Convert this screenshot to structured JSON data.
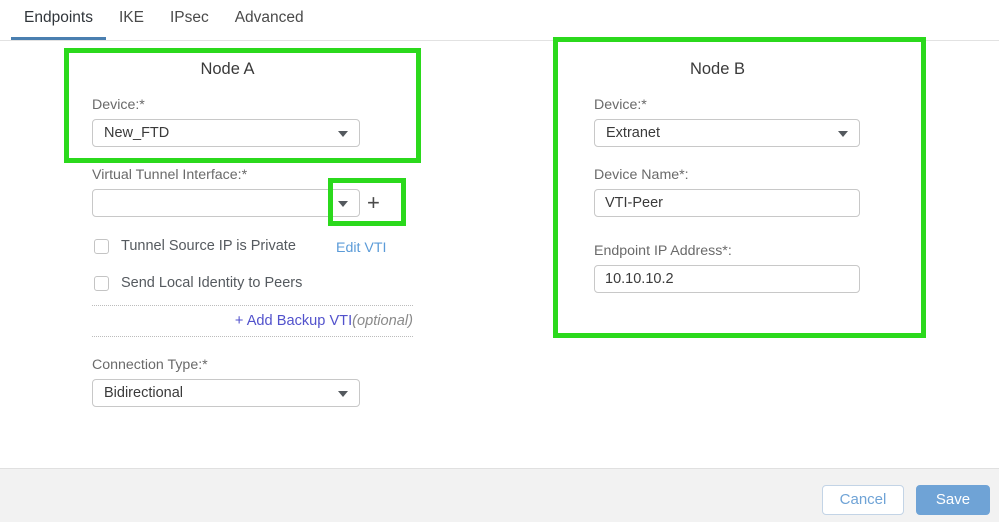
{
  "tabs": [
    {
      "label": "Endpoints",
      "active": true
    },
    {
      "label": "IKE",
      "active": false
    },
    {
      "label": "IPsec",
      "active": false
    },
    {
      "label": "Advanced",
      "active": false
    }
  ],
  "node_a": {
    "title": "Node A",
    "device_label": "Device:*",
    "device_value": "New_FTD",
    "vti_label": "Virtual Tunnel Interface:*",
    "vti_value": "",
    "add_vti_icon": "plus-icon",
    "checkbox_tunnel_source": "Tunnel Source IP is Private",
    "checkbox_send_identity": "Send Local Identity to Peers",
    "edit_vti_link": "Edit VTI",
    "add_backup_vti_link": "+ Add Backup VTI",
    "add_backup_vti_optional": "(optional)",
    "connection_type_label": "Connection Type:*",
    "connection_type_value": "Bidirectional"
  },
  "node_b": {
    "title": "Node B",
    "device_label": "Device:*",
    "device_value": "Extranet",
    "device_name_label": "Device Name*:",
    "device_name_value": "VTI-Peer",
    "endpoint_ip_label": "Endpoint IP Address*:",
    "endpoint_ip_value": "10.10.10.2"
  },
  "footer": {
    "cancel_label": "Cancel",
    "save_label": "Save"
  },
  "colors": {
    "annotation_green": "#2bd91c",
    "active_tab_underline": "#4a7fb0",
    "link_blue": "#5b9bd8",
    "backup_link_purple": "#5252cc",
    "save_button_blue": "#6fa3d6",
    "footer_background": "#f2f2f2"
  }
}
